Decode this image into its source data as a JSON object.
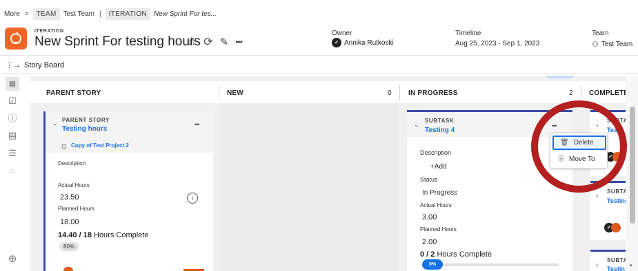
{
  "breadcrumb": {
    "more": "More",
    "team_tag": "TEAM",
    "team_name": "Test Team",
    "iteration_tag": "ITERATION",
    "iteration_name": "New Sprint For tes..."
  },
  "header": {
    "caption": "ITERATION",
    "title": "New Sprint For testing hours",
    "icons": [
      "star-icon",
      "refresh-icon",
      "pencil-icon",
      "more-icon"
    ]
  },
  "meta": {
    "owner_label": "Owner",
    "owner_value": "Annika Rutkoski",
    "timeline_label": "Timeline",
    "timeline_value": "Aug 25, 2023 - Sep 1, 2023",
    "team_label": "Team",
    "team_value": "Test Team"
  },
  "storyboard": {
    "label": "Story Board"
  },
  "columns": [
    {
      "title": "PARENT STORY",
      "count": ""
    },
    {
      "title": "NEW",
      "count": "0"
    },
    {
      "title": "IN PROGRESS",
      "count": "2"
    },
    {
      "title": "COMPLETE",
      "count": ""
    }
  ],
  "parent_card": {
    "type": "PARENT STORY",
    "name": "Testing hours",
    "project": "Copy of Test Project 2",
    "description_label": "Description",
    "actual_label": "Actual Hours",
    "actual_value": "23.50",
    "planned_label": "Planned Hours",
    "planned_value": "18.00",
    "progress_bold": "14.40 / 18",
    "progress_text": "Hours Complete",
    "progress_badge": "80%",
    "progress_fraction": 0.8
  },
  "inprogress_card": {
    "type": "SUBTASK",
    "name": "Testing 4",
    "description_label": "Description",
    "add_label": "+Add",
    "status_label": "Status",
    "status_value": "In Progress",
    "actual_label": "Actual Hours",
    "actual_value": "3.00",
    "planned_label": "Planned Hours",
    "planned_value": "2.00",
    "progress_bold": "0 / 2",
    "progress_text": "Hours Complete",
    "progress_badge": "0%",
    "progress_fraction": 0.0
  },
  "complete_cards": [
    {
      "type": "SUBTA",
      "name": "Testi"
    },
    {
      "type": "SUBTA",
      "name": "Testing"
    },
    {
      "type": "SUBTA",
      "name": "Testin"
    }
  ],
  "context_menu": {
    "items": [
      {
        "label": "Delete",
        "icon": "trash-icon"
      },
      {
        "label": "Move To",
        "icon": "move-to-icon"
      }
    ]
  },
  "colors": {
    "accent_blue": "#1473e6",
    "iteration_orange": "#f26522",
    "highlight_red": "#b41f1f",
    "card_border": "#3a4aa6"
  }
}
